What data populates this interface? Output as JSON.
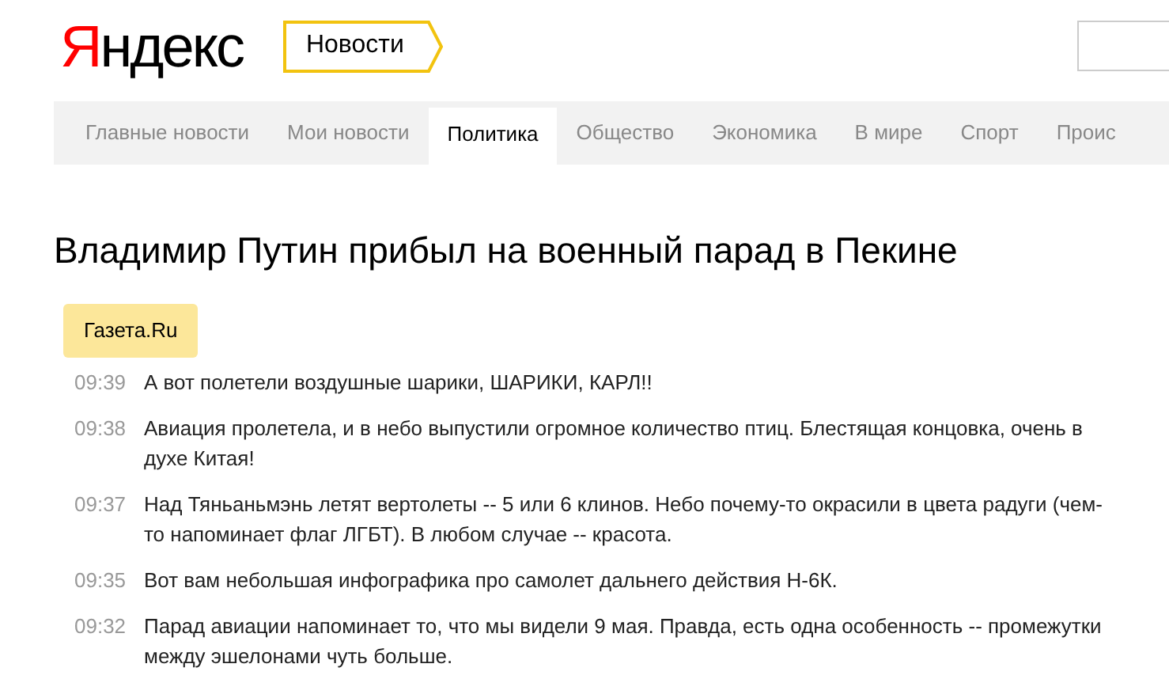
{
  "header": {
    "logo": "Яндекс",
    "service": "Новости"
  },
  "tabs": [
    {
      "label": "Главные новости",
      "selected": false
    },
    {
      "label": "Мои новости",
      "selected": false
    },
    {
      "label": "Политика",
      "selected": true
    },
    {
      "label": "Общество",
      "selected": false
    },
    {
      "label": "Экономика",
      "selected": false
    },
    {
      "label": "В мире",
      "selected": false
    },
    {
      "label": "Спорт",
      "selected": false
    },
    {
      "label": "Проис",
      "selected": false
    }
  ],
  "headline": "Владимир Путин прибыл на военный парад в Пекине",
  "source": "Газета.Ru",
  "entries": [
    {
      "time": "09:39",
      "text": "А вот полетели воздушные шарики, ШАРИКИ, КАРЛ!!"
    },
    {
      "time": "09:38",
      "text": "Авиация пролетела, и в небо выпустили огромное количество птиц. Блестящая концовка, очень в духе Китая!"
    },
    {
      "time": "09:37",
      "text": "Над Тяньаньмэнь летят вертолеты -- 5 или 6 клинов. Небо почему-то окрасили в цвета радуги (чем-то напоминает флаг ЛГБТ). В любом случае -- красота."
    },
    {
      "time": "09:35",
      "text": "Вот вам небольшая инфографика про самолет дальнего действия Н-6К."
    },
    {
      "time": "09:32",
      "text": "Парад авиации напоминает то, что мы видели 9 мая. Правда, есть одна особенность -- промежутки между эшелонами чуть больше."
    }
  ]
}
